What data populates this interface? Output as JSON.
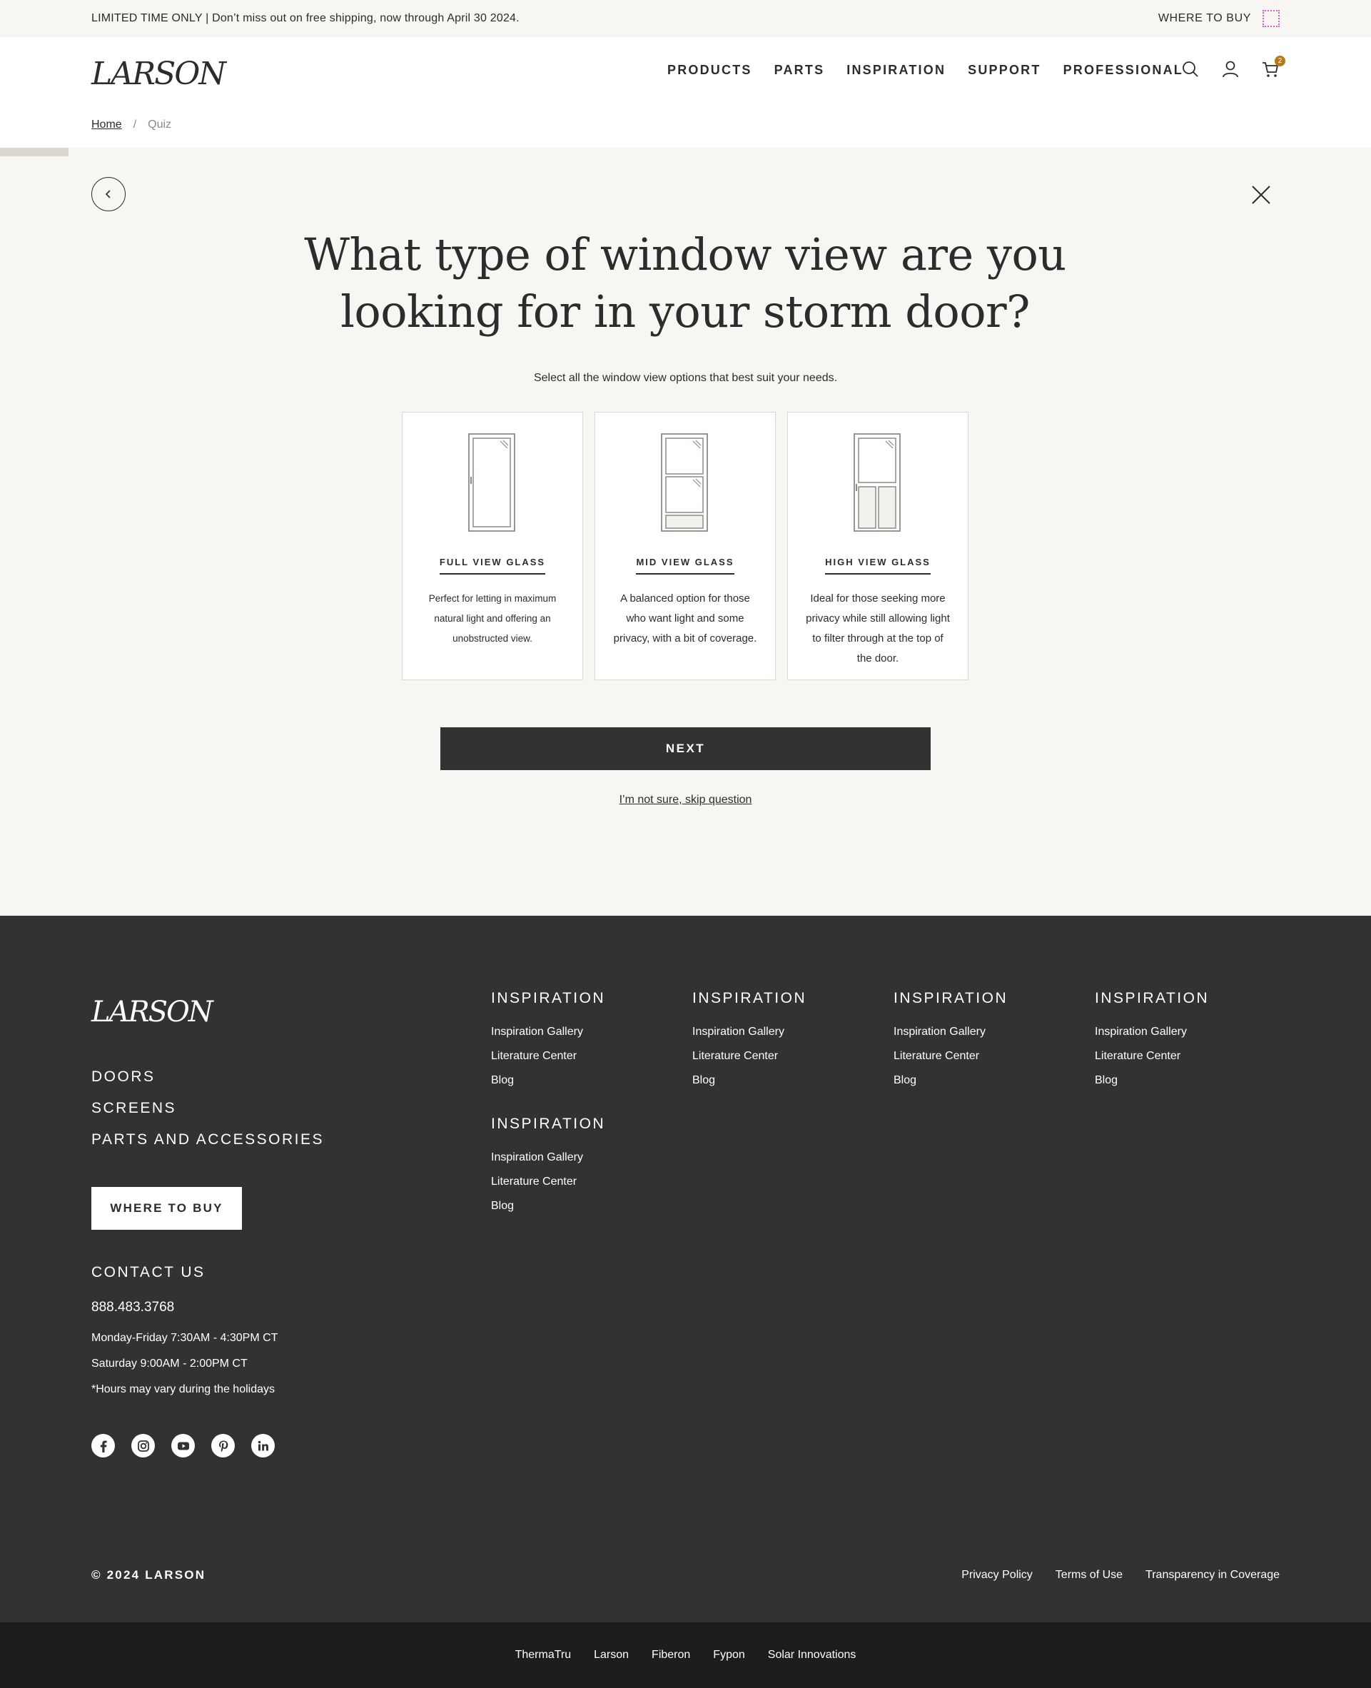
{
  "promo": {
    "text": "LIMITED TIME ONLY | Don’t miss out on free shipping, now through April 30 2024.",
    "where_to_buy": "WHERE TO BUY"
  },
  "header": {
    "logo": "LARSON",
    "nav": [
      "PRODUCTS",
      "PARTS",
      "INSPIRATION",
      "SUPPORT",
      "PROFESSIONAL"
    ],
    "cart_count": "2",
    "icons": [
      "search-icon",
      "account-icon",
      "cart-icon"
    ]
  },
  "breadcrumb": {
    "home": "Home",
    "separator": "/",
    "current": "Quiz"
  },
  "quiz": {
    "progress_fraction": 0.05,
    "question": "What type of window view are you looking for in your storm door?",
    "subtitle": "Select all the window view options that best suit your needs.",
    "options": [
      {
        "title": "FULL VIEW GLASS",
        "description": "Perfect for letting in maximum natural light and offering an unobstructed view."
      },
      {
        "title": "MID VIEW GLASS",
        "description": "A balanced option for those who want light and some privacy, with a bit of coverage."
      },
      {
        "title": "HIGH VIEW GLASS",
        "description": "Ideal for those seeking more privacy while still allowing light to filter through at the top of the door."
      }
    ],
    "next_label": "NEXT",
    "skip_label": "I’m not sure, skip question"
  },
  "footer": {
    "logo": "LARSON",
    "main_links": [
      "DOORS",
      "SCREENS",
      "PARTS AND ACCESSORIES"
    ],
    "where_to_buy": "WHERE TO BUY",
    "contact": {
      "title": "CONTACT US",
      "phone": "888.483.3768",
      "hours": [
        "Monday-Friday 7:30AM - 4:30PM CT",
        "Saturday 9:00AM - 2:00PM CT",
        "*Hours may vary during the holidays"
      ]
    },
    "social": [
      "facebook-icon",
      "instagram-icon",
      "youtube-icon",
      "pinterest-icon",
      "linkedin-icon"
    ],
    "columns": [
      {
        "title": "INSPIRATION",
        "links": [
          "Inspiration Gallery",
          "Literature Center",
          "Blog"
        ]
      },
      {
        "title": "INSPIRATION",
        "links": [
          "Inspiration Gallery",
          "Literature Center",
          "Blog"
        ]
      },
      {
        "title": "INSPIRATION",
        "links": [
          "Inspiration Gallery",
          "Literature Center",
          "Blog"
        ]
      },
      {
        "title": "INSPIRATION",
        "links": [
          "Inspiration Gallery",
          "Literature Center",
          "Blog"
        ]
      },
      {
        "title": "INSPIRATION",
        "links": [
          "Inspiration Gallery",
          "Literature Center",
          "Blog"
        ]
      }
    ],
    "copyright": "© 2024 LARSON",
    "legal": [
      "Privacy Policy",
      "Terms of Use",
      "Transparency in Coverage"
    ],
    "brands": [
      "ThermaTru",
      "Larson",
      "Fiberon",
      "Fypon",
      "Solar Innovations"
    ]
  },
  "colors": {
    "accent": "#b27a1d",
    "dark": "#333132",
    "background": "#f7f6f2",
    "brand_bar": "#1e1d1d"
  }
}
